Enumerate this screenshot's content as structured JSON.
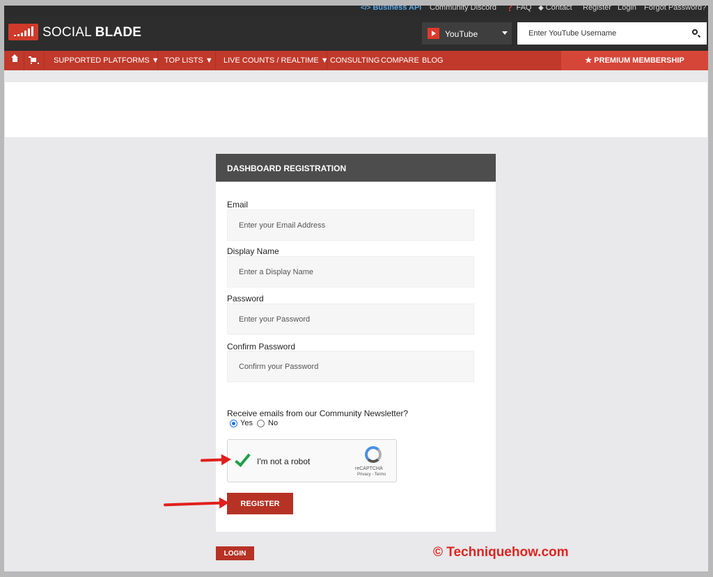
{
  "top_links": {
    "business_api": "Business API",
    "community_discord": "Community Discord",
    "faq": "FAQ",
    "contact": "Contact",
    "register": "Register",
    "login": "Login",
    "forgot_password": "Forgot Password?"
  },
  "header": {
    "logo_social": "SOCIAL",
    "logo_blade": "BLADE",
    "platform_selected": "YouTube",
    "search_placeholder": "Enter YouTube Username"
  },
  "nav": {
    "supported_platforms": "SUPPORTED PLATFORMS ▼",
    "top_lists": "TOP LISTS ▼",
    "live_counts": "LIVE COUNTS / REALTIME ▼",
    "consulting": "CONSULTING",
    "compare": "COMPARE",
    "blog": "BLOG",
    "premium": "★ PREMIUM MEMBERSHIP"
  },
  "form": {
    "title": "DASHBOARD REGISTRATION",
    "email_label": "Email",
    "email_placeholder": "Enter your Email Address",
    "display_label": "Display Name",
    "display_placeholder": "Enter a Display Name",
    "password_label": "Password",
    "password_placeholder": "Enter your Password",
    "confirm_label": "Confirm Password",
    "confirm_placeholder": "Confirm your Password",
    "newsletter_question": "Receive emails from our Community Newsletter?",
    "yes": "Yes",
    "no": "No",
    "newsletter_selected": "Yes",
    "captcha_label": "I'm not a robot",
    "captcha_brand": "reCAPTCHA",
    "captcha_terms": "Privacy - Terms",
    "register_button": "REGISTER",
    "login_button": "LOGIN"
  },
  "watermark": "© Techniquehow.com",
  "colors": {
    "brand_red": "#c0392b",
    "header_dark": "#2d2d2d",
    "annotation_red": "#e0201c"
  }
}
